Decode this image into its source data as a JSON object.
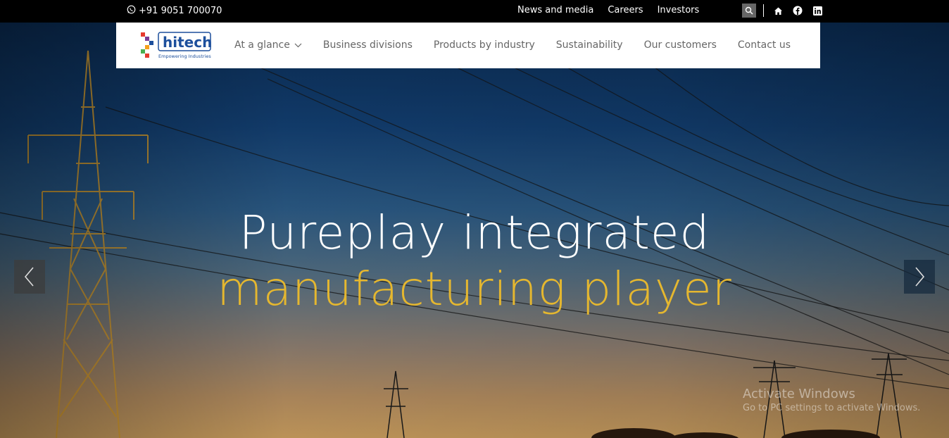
{
  "topbar": {
    "phone": "+91 9051 700070",
    "links": [
      "News and media",
      "Careers",
      "Investors"
    ],
    "icons": [
      "search-icon",
      "home-icon",
      "facebook-icon",
      "linkedin-icon"
    ]
  },
  "logo": {
    "name": "hitech",
    "tagline": "Empowering Industries"
  },
  "nav": {
    "items": [
      "At a glance",
      "Business divisions",
      "Products by industry",
      "Sustainability",
      "Our customers",
      "Contact us"
    ]
  },
  "hero": {
    "line1": "Pureplay integrated",
    "line2": "manufacturing player",
    "accent_color": "#e5b72f"
  },
  "watermark": {
    "title": "Activate Windows",
    "subtitle": "Go to PC settings to activate Windows."
  }
}
